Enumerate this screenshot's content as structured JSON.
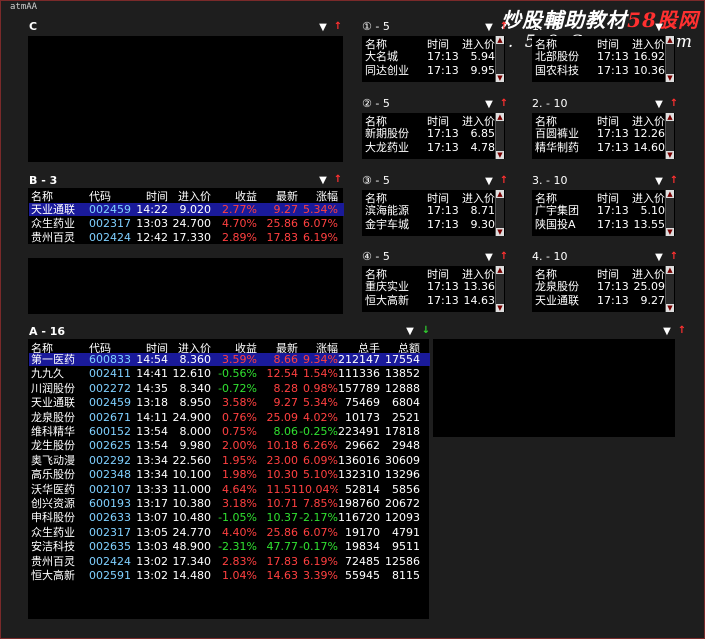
{
  "window_title": "atmAA",
  "watermark": {
    "prefix": "炒股輔助教材",
    "brand": "58股网",
    "url": "w w w . 5 8 G u . c o m"
  },
  "panel_c": {
    "title": "C"
  },
  "panel_b": {
    "title": "B  - 3",
    "headers": [
      "名称",
      "代码",
      "时间",
      "进入价",
      "收益",
      "最新",
      "涨幅"
    ],
    "rows": [
      {
        "name": "天业通联",
        "code": "002459",
        "time": "14:22",
        "entry": "9.020",
        "gain": "2.77%",
        "latest": "9.27",
        "change": "5.34%"
      },
      {
        "name": "众生药业",
        "code": "002317",
        "time": "13:03",
        "entry": "24.700",
        "gain": "4.70%",
        "latest": "25.86",
        "change": "6.07%"
      },
      {
        "name": "贵州百灵",
        "code": "002424",
        "time": "12:42",
        "entry": "17.330",
        "gain": "2.89%",
        "latest": "17.83",
        "change": "6.19%"
      }
    ]
  },
  "panel_a": {
    "title": "A  - 16",
    "headers": [
      "名称",
      "代码",
      "时间",
      "进入价",
      "收益",
      "最新",
      "涨幅",
      "总手",
      "总额"
    ],
    "rows": [
      {
        "name": "第一医药",
        "code": "600833",
        "time": "14:54",
        "entry": "8.360",
        "gain": "3.59%",
        "latest": "8.66",
        "change": "9.34%",
        "vol": "212147",
        "amt": "17554",
        "gc": "red",
        "lc": "red",
        "cc": "red"
      },
      {
        "name": "九九久",
        "code": "002411",
        "time": "14:41",
        "entry": "12.610",
        "gain": "-0.56%",
        "latest": "12.54",
        "change": "1.54%",
        "vol": "111336",
        "amt": "13852",
        "gc": "green",
        "lc": "red",
        "cc": "red"
      },
      {
        "name": "川润股份",
        "code": "002272",
        "time": "14:35",
        "entry": "8.340",
        "gain": "-0.72%",
        "latest": "8.28",
        "change": "0.98%",
        "vol": "157789",
        "amt": "12888",
        "gc": "green",
        "lc": "red",
        "cc": "red"
      },
      {
        "name": "天业通联",
        "code": "002459",
        "time": "13:18",
        "entry": "8.950",
        "gain": "3.58%",
        "latest": "9.27",
        "change": "5.34%",
        "vol": "75469",
        "amt": "6804",
        "gc": "red",
        "lc": "red",
        "cc": "red"
      },
      {
        "name": "龙泉股份",
        "code": "002671",
        "time": "14:11",
        "entry": "24.900",
        "gain": "0.76%",
        "latest": "25.09",
        "change": "4.02%",
        "vol": "10173",
        "amt": "2521",
        "gc": "red",
        "lc": "red",
        "cc": "red"
      },
      {
        "name": "维科精华",
        "code": "600152",
        "time": "13:54",
        "entry": "8.000",
        "gain": "0.75%",
        "latest": "8.06",
        "change": "-0.25%",
        "vol": "223491",
        "amt": "17818",
        "gc": "red",
        "lc": "green",
        "cc": "green"
      },
      {
        "name": "龙生股份",
        "code": "002625",
        "time": "13:54",
        "entry": "9.980",
        "gain": "2.00%",
        "latest": "10.18",
        "change": "6.26%",
        "vol": "29662",
        "amt": "2948",
        "gc": "red",
        "lc": "red",
        "cc": "red"
      },
      {
        "name": "奥飞动漫",
        "code": "002292",
        "time": "13:34",
        "entry": "22.560",
        "gain": "1.95%",
        "latest": "23.00",
        "change": "6.09%",
        "vol": "136016",
        "amt": "30609",
        "gc": "red",
        "lc": "red",
        "cc": "red"
      },
      {
        "name": "高乐股份",
        "code": "002348",
        "time": "13:34",
        "entry": "10.100",
        "gain": "1.98%",
        "latest": "10.30",
        "change": "5.10%",
        "vol": "132310",
        "amt": "13296",
        "gc": "red",
        "lc": "red",
        "cc": "red"
      },
      {
        "name": "沃华医药",
        "code": "002107",
        "time": "13:33",
        "entry": "11.000",
        "gain": "4.64%",
        "latest": "11.51",
        "change": "10.04%",
        "vol": "52814",
        "amt": "5856",
        "gc": "red",
        "lc": "red",
        "cc": "red"
      },
      {
        "name": "创兴资源",
        "code": "600193",
        "time": "13:17",
        "entry": "10.380",
        "gain": "3.18%",
        "latest": "10.71",
        "change": "7.85%",
        "vol": "198760",
        "amt": "20672",
        "gc": "red",
        "lc": "red",
        "cc": "red"
      },
      {
        "name": "申科股份",
        "code": "002633",
        "time": "13:07",
        "entry": "10.480",
        "gain": "-1.05%",
        "latest": "10.37",
        "change": "-2.17%",
        "vol": "116720",
        "amt": "12093",
        "gc": "green",
        "lc": "green",
        "cc": "green"
      },
      {
        "name": "众生药业",
        "code": "002317",
        "time": "13:05",
        "entry": "24.770",
        "gain": "4.40%",
        "latest": "25.86",
        "change": "6.07%",
        "vol": "19170",
        "amt": "4791",
        "gc": "red",
        "lc": "red",
        "cc": "red"
      },
      {
        "name": "安洁科技",
        "code": "002635",
        "time": "13:03",
        "entry": "48.900",
        "gain": "-2.31%",
        "latest": "47.77",
        "change": "-0.17%",
        "vol": "19834",
        "amt": "9511",
        "gc": "green",
        "lc": "green",
        "cc": "green"
      },
      {
        "name": "贵州百灵",
        "code": "002424",
        "time": "13:02",
        "entry": "17.340",
        "gain": "2.83%",
        "latest": "17.83",
        "change": "6.19%",
        "vol": "72485",
        "amt": "12586",
        "gc": "red",
        "lc": "red",
        "cc": "red"
      },
      {
        "name": "恒大高新",
        "code": "002591",
        "time": "13:02",
        "entry": "14.480",
        "gain": "1.04%",
        "latest": "14.63",
        "change": "3.39%",
        "vol": "55945",
        "amt": "8115",
        "gc": "red",
        "lc": "red",
        "cc": "red"
      }
    ]
  },
  "mini_headers": [
    "名称",
    "时间",
    "进入价"
  ],
  "mini_panels": [
    {
      "title": "① - 5",
      "rows": [
        {
          "name": "大名城",
          "time": "17:13",
          "val": "5.94"
        },
        {
          "name": "同达创业",
          "time": "17:13",
          "val": "9.95"
        }
      ]
    },
    {
      "title": "1. - 5",
      "rows": [
        {
          "name": "北部股份",
          "time": "17:13",
          "val": "16.92"
        },
        {
          "name": "国农科技",
          "time": "17:13",
          "val": "10.36"
        }
      ]
    },
    {
      "title": "② - 5",
      "rows": [
        {
          "name": "新期股份",
          "time": "17:13",
          "val": "6.85"
        },
        {
          "name": "大龙药业",
          "time": "17:13",
          "val": "4.78"
        }
      ]
    },
    {
      "title": "2. - 10",
      "rows": [
        {
          "name": "百圆裤业",
          "time": "17:13",
          "val": "12.26"
        },
        {
          "name": "精华制药",
          "time": "17:13",
          "val": "14.60"
        }
      ]
    },
    {
      "title": "③ - 5",
      "rows": [
        {
          "name": "滨海能源",
          "time": "17:13",
          "val": "8.71"
        },
        {
          "name": "金宇车城",
          "time": "17:13",
          "val": "9.30"
        }
      ]
    },
    {
      "title": "3. - 10",
      "rows": [
        {
          "name": "广宇集团",
          "time": "17:13",
          "val": "5.10"
        },
        {
          "name": "陕国投A",
          "time": "17:13",
          "val": "13.55"
        }
      ]
    },
    {
      "title": "④ - 5",
      "rows": [
        {
          "name": "重庆实业",
          "time": "17:13",
          "val": "13.36"
        },
        {
          "name": "恒大高新",
          "time": "17:13",
          "val": "14.63"
        }
      ]
    },
    {
      "title": "4. - 10",
      "rows": [
        {
          "name": "龙泉股份",
          "time": "17:13",
          "val": "25.09"
        },
        {
          "name": "天业通联",
          "time": "17:13",
          "val": "9.27"
        }
      ]
    }
  ],
  "colors": {
    "up": "#ff4040",
    "down": "#30e030",
    "selected_row": "#1a1a9a",
    "border": "#7a2a2a",
    "panel_bg": "#000000"
  }
}
